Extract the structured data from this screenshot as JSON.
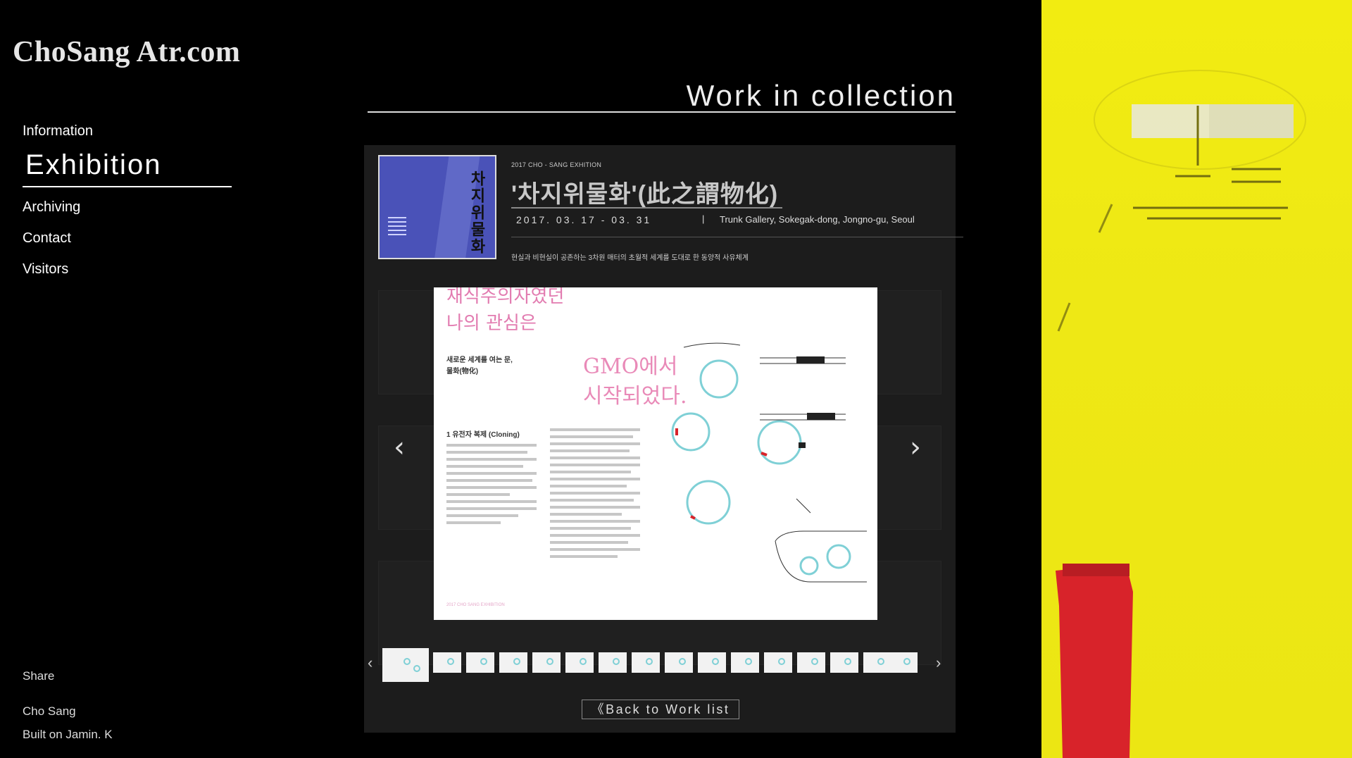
{
  "site": {
    "logo": "ChoSang Atr.com"
  },
  "nav": {
    "items": [
      "Information",
      "Exhibition",
      "Archiving",
      "Contact",
      "Visitors"
    ],
    "active": "Exhibition"
  },
  "sidebar_footer": {
    "share": "Share",
    "artist": "Cho Sang",
    "built": "Built on Jamin. K"
  },
  "page": {
    "title": "Work in collection"
  },
  "work": {
    "meta": "2017   CHO - SANG   EXHITION",
    "title": "'차지위물화'(此之謂物化)",
    "dates": "2017. 03. 17  -  03. 31",
    "separator": "|",
    "venue": "Trunk Gallery, Sokegak-dong, Jongno-gu, Seoul",
    "description": "현실과 비현실이 공존하는 3차원 매터의 초월적 세계를 도대로 한 동양적 사유체계",
    "cover_text": "차지위물화"
  },
  "viewer": {
    "heading_pink": "재식주의자였던\n나의 관심은",
    "subheading": "새로운 세계를 여는 문,\n물화(物化)",
    "gmo_text": "GMO에서\n시작되었다.",
    "section_title": "1 유전자 복제 (Cloning)",
    "footer": "2017 CHO SANG EXHIBITION",
    "prev": "‹",
    "next": "›"
  },
  "thumbnails": {
    "count": 16,
    "active_index": 0,
    "prev": "‹",
    "next": "›"
  },
  "back_button": "《Back to Work list",
  "colors": {
    "background": "#000000",
    "panel": "#1c1c1c",
    "cover_blue": "#4a52b8",
    "pink": "#e27bb0",
    "cyan": "#7fd0d6",
    "art_yellow": "#f2ec12",
    "art_red": "#d8232a"
  }
}
